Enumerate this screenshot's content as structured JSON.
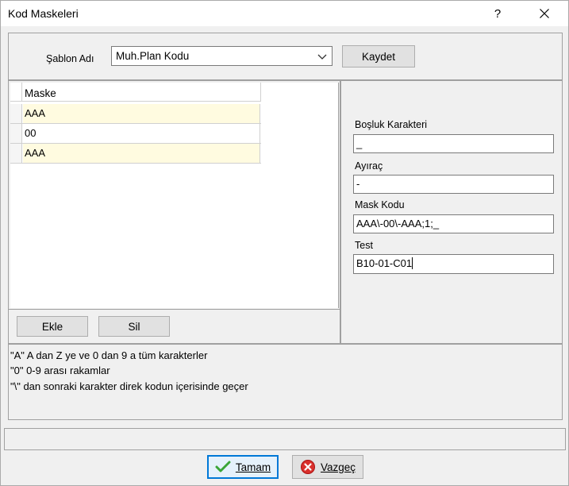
{
  "window": {
    "title": "Kod Maskeleri",
    "help": "?"
  },
  "template": {
    "label": "Şablon Adı",
    "selected": "Muh.Plan Kodu",
    "save_label": "Kaydet"
  },
  "grid": {
    "header": "Maske",
    "rows": [
      {
        "value": "AAA"
      },
      {
        "value": "00"
      },
      {
        "value": "AAA"
      }
    ],
    "add_label": "Ekle",
    "delete_label": "Sil"
  },
  "settings": {
    "space_char_label": "Boşluk Karakteri",
    "space_char_value": "_",
    "separator_label": "Ayıraç",
    "separator_value": "-",
    "mask_code_label": "Mask Kodu",
    "mask_code_value": "AAA\\-00\\-AAA;1;_",
    "test_label": "Test",
    "test_value": "B10-01-C01"
  },
  "info": {
    "lines": [
      "\"A\"   A dan Z ye ve 0 dan 9 a tüm karakterler",
      "\"0\"   0-9 arası rakamlar",
      "\"\\\"   dan sonraki karakter direk kodun içerisinde geçer"
    ]
  },
  "footer": {
    "ok_label": "Tamam",
    "cancel_label": "Vazgeç"
  }
}
